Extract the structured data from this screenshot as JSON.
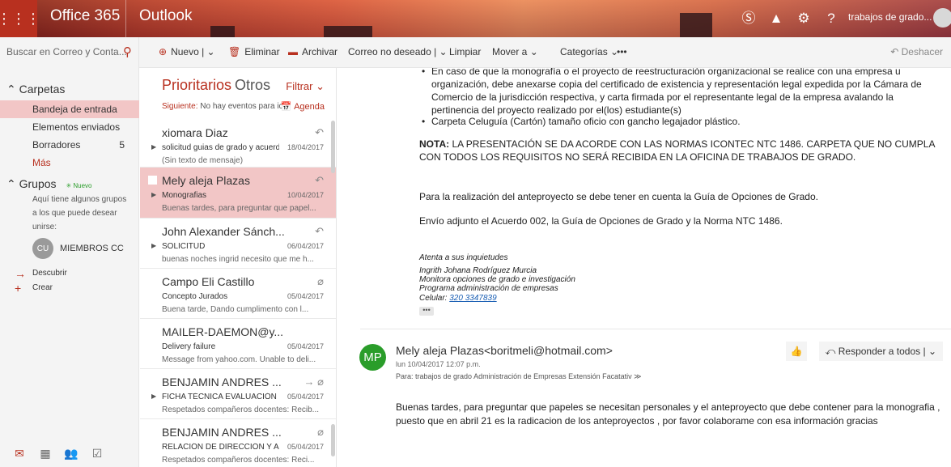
{
  "topbar": {
    "app_launcher_icon": "waffle-icon",
    "suite": "Office 365",
    "app": "Outlook",
    "user": "trabajos de grado..."
  },
  "toolbar": {
    "search_placeholder": "Buscar en Correo y Conta...",
    "new_label": "Nuevo |",
    "delete_label": "Eliminar",
    "archive_label": "Archivar",
    "junk_label": "Correo no deseado |",
    "clean_label": "Limpiar",
    "move_label": "Mover a",
    "categories_label": "Categorías",
    "more_label": "•••",
    "undo_label": "Deshacer"
  },
  "nav": {
    "folders_header": "Carpetas",
    "folders": [
      {
        "label": "Bandeja de entrada",
        "count": ""
      },
      {
        "label": "Elementos enviados",
        "count": ""
      },
      {
        "label": "Borradores",
        "count": "5"
      }
    ],
    "more": "Más",
    "groups_header": "Grupos",
    "groups_new": "Nuevo",
    "groups_text": "Aquí tiene algunos grupos a los que puede desear unirse:",
    "member_initials": "CU",
    "member_name": "MIEMBROS CC",
    "discover": "Descubrir",
    "create": "Crear"
  },
  "list": {
    "tab_focused": "Prioritarios",
    "tab_other": "Otros",
    "filter": "Filtrar",
    "next_label": "Siguiente:",
    "next_text": "No hay eventos para ic",
    "agenda": "Agenda",
    "items": [
      {
        "sender": "xiomara Diaz",
        "subject": "solicitud guias de grado y acuerdo",
        "date": "18/04/2017",
        "preview": "(Sin texto de mensaje)"
      },
      {
        "sender": "Mely aleja Plazas",
        "subject": "Monografias",
        "date": "10/04/2017",
        "preview": "Buenas tardes, para preguntar que papel..."
      },
      {
        "sender": "John Alexander Sánch...",
        "subject": "SOLICITUD",
        "date": "06/04/2017",
        "preview": "buenas noches ingrid necesito que me h..."
      },
      {
        "sender": "Campo Eli Castillo",
        "subject": "Concepto Jurados",
        "date": "05/04/2017",
        "preview": "Buena tarde,  Dando cumplimento con l..."
      },
      {
        "sender": "MAILER-DAEMON@y...",
        "subject": "Delivery failure",
        "date": "05/04/2017",
        "preview": "Message from yahoo.com. Unable to deli..."
      },
      {
        "sender": "BENJAMIN ANDRES ...",
        "subject": "FICHA TÉCNICA EVALUACIÓN DE",
        "date": "05/04/2017",
        "preview": "Respetados compañeros docentes:  Recib..."
      },
      {
        "sender": "BENJAMIN ANDRES ...",
        "subject": "RELACIÓN DE DIRECCIÓN Y ASES",
        "date": "05/04/2017",
        "preview": "Respetados compañeros docentes:  Reci..."
      }
    ]
  },
  "reading": {
    "bullet1": "En caso de que la monografía o el proyecto de reestructuración organizacional se realice con una empresa u organización, debe anexarse copia del certificado de existencia y representación legal expedida por la Cámara de Comercio de la jurisdicción respectiva, y carta firmada por el representante legal de la empresa avalando la pertinencia del proyecto realizado por el(los) estudiante(s)",
    "bullet2": "Carpeta Celuguía (Cartón) tamaño oficio con gancho legajador plástico.",
    "nota_label": "NOTA:",
    "nota_text": " LA PRESENTACIÓN SE DA ACORDE CON LAS NORMAS ICONTEC NTC 1486. CARPETA QUE NO CUMPLA CON TODOS LOS REQUISITOS NO SERÁ RECIBIDA EN LA OFICINA DE TRABAJOS DE GRADO.",
    "para1": "Para la realización del anteproyecto se debe tener en cuenta la Guía de Opciones de Grado.",
    "para2": "Envío adjunto el Acuerdo 002, la Guía de Opciones de Grado y la Norma NTC 1486.",
    "sig1": "Atenta a sus inquietudes",
    "sig2": "Ingrith Johana Rodríguez Murcia",
    "sig3": "Monitora opciones de grado e investigación",
    "sig4": "Programa administración de empresas",
    "sig5_label": "Celular: ",
    "sig5_phone": "320 3347839",
    "msg2": {
      "initials": "MP",
      "from": "Mely aleja Plazas<boritmeli@hotmail.com>",
      "date": "lun 10/04/2017 12:07 p.m.",
      "to": "Para:  trabajos de grado Administración de Empresas Extensión Facatativ",
      "reply_all": "Responder a todos",
      "body": "Buenas tardes, para preguntar que papeles se necesitan personales y el anteproyecto que debe contener para la monografia , puesto que en abril 21 es la radicacion de los anteproyectos , por favor colaborame con esa información gracias"
    }
  },
  "colors": {
    "accent": "#b8301f",
    "selected": "#f2c6c6",
    "avatar_mp": "#2a9d2a"
  }
}
